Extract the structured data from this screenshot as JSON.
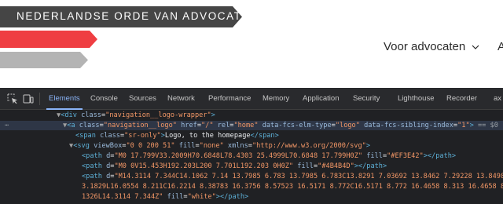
{
  "site": {
    "logo_text": "NEDERLANDSE ORDE VAN ADVOCATEN",
    "nav_link": "Voor advocaten",
    "nav_next": "A",
    "colors": {
      "dark_bar": "#454545",
      "red_bar": "#EF3E42",
      "grey_bar": "#B4B4B4"
    }
  },
  "devtools": {
    "tabs": [
      "Elements",
      "Console",
      "Sources",
      "Network",
      "Performance",
      "Memory",
      "Application",
      "Security",
      "Lighthouse",
      "Recorder",
      "ax"
    ],
    "active_tab": "Elements",
    "icons": [
      "inspect-element-icon",
      "device-toolbar-icon"
    ],
    "selected_marker": "== $0",
    "dom_lines": [
      {
        "indent": 0,
        "arrow": "▼",
        "text": "<div class=\"navigation__logo-wrapper\">"
      },
      {
        "indent": 1,
        "arrow": "▼",
        "text": "<a class=\"navigation__logo\" href=\"/\" rel=\"home\" data-fcs-elm-type=\"logo\" data-fcs-sibling-index=\"1\">"
      },
      {
        "indent": 2,
        "arrow": "",
        "text": "<span class=\"sr-only\">Logo, to the homepage</span>"
      },
      {
        "indent": 2,
        "arrow": "▼",
        "text": "<svg viewBox=\"0 0 200 51\" fill=\"none\" xmlns=\"http://www.w3.org/2000/svg\">"
      },
      {
        "indent": 3,
        "arrow": "",
        "text": "<path d=\"M0 17.799V33.2009H70.6848L78.4303 25.4999L70.6848 17.799H0Z\" fill=\"#EF3E42\"></path>"
      },
      {
        "indent": 3,
        "arrow": "",
        "text": "<path d=\"M0 0V15.453H192.203L200 7.701L192.203 0H0Z\" fill=\"#4B4B4D\"></path>"
      },
      {
        "indent": 3,
        "arrow": "",
        "text": "<path d=\"M14.3114 7.344C14.1062 7.14 13.7985 6.783 13.7985 6.783C13.8291 7.03692 13.8462 7.29228 13.8498"
      },
      {
        "indent": 3,
        "arrow": "",
        "text": "3.1829L16.0554 8.211C16.2214 8.38783 16.3756 8.57523 16.5171 8.772C16.5171 8.772 16.4658 8.313 16.4658 8."
      },
      {
        "indent": 3,
        "arrow": "",
        "text": "1326L14.3114 7.344Z\" fill=\"white\"></path>"
      }
    ]
  }
}
